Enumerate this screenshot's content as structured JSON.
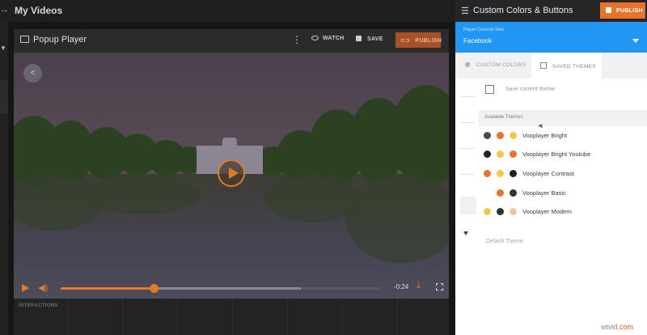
{
  "topbar": {
    "expand_icon": "expand-icon",
    "title": "My Videos"
  },
  "player": {
    "title": "Popup Player",
    "more_icon": "more-vertical-icon",
    "watch_label": "WATCH",
    "save_label": "SAVE",
    "publish_label": "PUBLISH",
    "controls": {
      "time": "-0:24",
      "progress": 0.29,
      "buffered": 0.75
    },
    "interactions_label": "INTERACTIONS"
  },
  "panel": {
    "title": "Custom Colors & Buttons",
    "publish_label": "PUBLISH",
    "skin_label": "Player Controls Skin",
    "skin_value": "Facebook",
    "tabs": [
      {
        "label": "CUSTOM COLORS",
        "icon": "droplet-icon"
      },
      {
        "label": "SAVED THEMES",
        "icon": "copy-icon",
        "active": true
      }
    ],
    "save_current_label": "Save current theme",
    "available_label": "Available Themes",
    "themes": [
      {
        "name": "Vooplayer Bright",
        "colors": [
          "#4a4a4a",
          "#e8732a",
          "#f2c94c"
        ]
      },
      {
        "name": "Vooplayer Bright Youtube",
        "colors": [
          "#222222",
          "#f2c94c",
          "#e8732a"
        ]
      },
      {
        "name": "Vooplayer Contrast",
        "colors": [
          "#e8732a",
          "#f2c94c",
          "#222222"
        ]
      },
      {
        "name": "Vooplayer Basic",
        "colors": [
          "#e8732a",
          "#333333"
        ]
      },
      {
        "name": "Vooplayer Modern",
        "colors": [
          "#f2c94c",
          "#333333",
          "#f0c4a4"
        ]
      }
    ],
    "default_label": "Default Theme"
  },
  "watermark": {
    "name": "wtvid",
    "tld": ".com"
  },
  "colors": {
    "accent": "#e8732a",
    "skin_bar": "#2196f3",
    "dark_bg": "#161616"
  }
}
